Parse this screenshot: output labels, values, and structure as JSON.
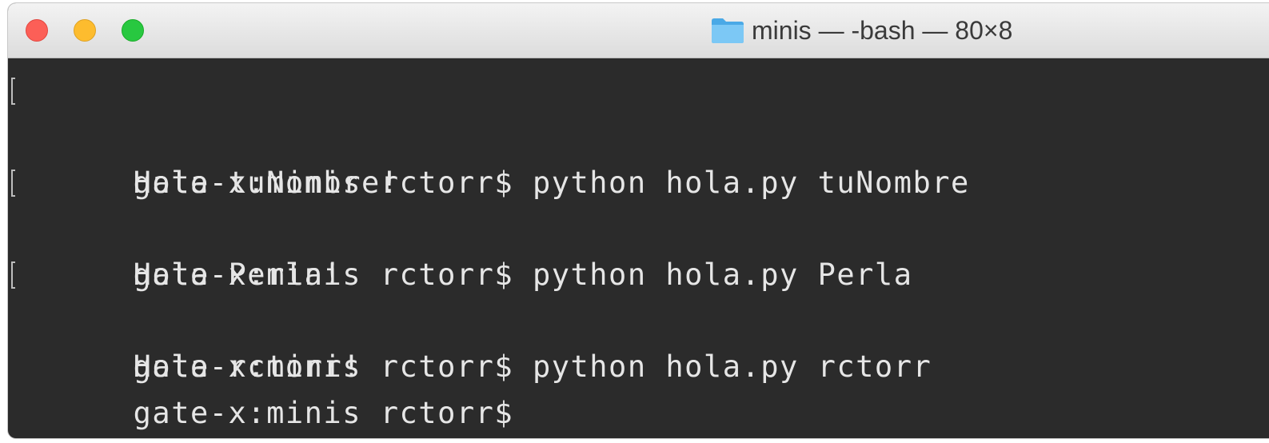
{
  "window": {
    "title": "minis — -bash — 80×8",
    "folder_icon": "folder-icon"
  },
  "terminal": {
    "lines": [
      {
        "text": "gate-x:minis rctorr$ python hola.py tuNombre",
        "marked": true
      },
      {
        "text": "Hola tuNombre!",
        "marked": false
      },
      {
        "text": "gate-x:minis rctorr$ python hola.py Perla",
        "marked": true
      },
      {
        "text": "Hola Perla!",
        "marked": false
      },
      {
        "text": "gate-x:minis rctorr$ python hola.py rctorr",
        "marked": true
      },
      {
        "text": "Hola rctorr!",
        "marked": false
      },
      {
        "text": "gate-x:minis rctorr$",
        "marked": false
      }
    ]
  },
  "colors": {
    "background": "#2b2b2b",
    "text": "#e6e6e6",
    "close": "#fc5f57",
    "minimize": "#fdbc2e",
    "maximize": "#28c840",
    "folder": "#5bb8f0"
  }
}
